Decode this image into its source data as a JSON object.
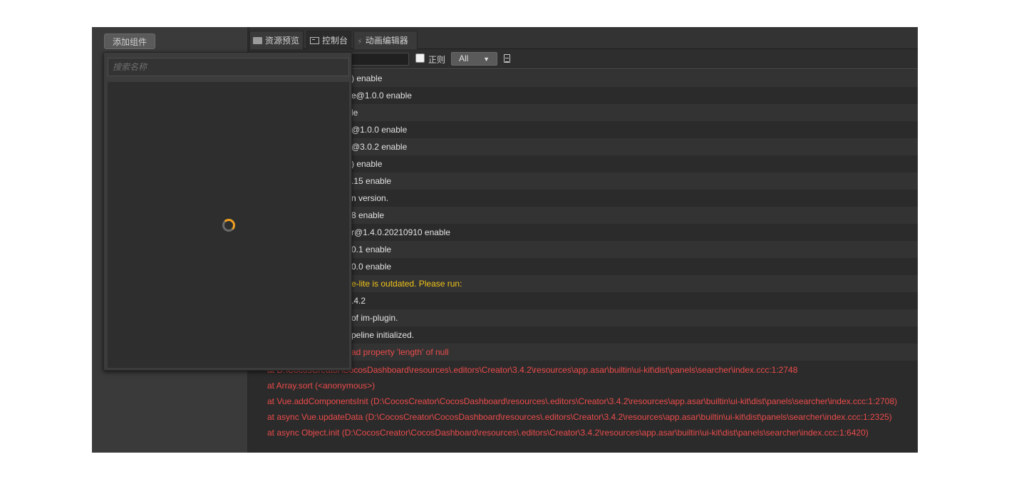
{
  "inspector": {
    "add_component_label": "添加组件"
  },
  "tabs": {
    "assets": "资源预览",
    "console": "控制台",
    "animation": "动画编辑器"
  },
  "filter": {
    "regex_label": "正则",
    "level_value": "All"
  },
  "popup": {
    "search_placeholder": "搜索名称"
  },
  "log": {
    "rows": [
      {
        "text": ") enable",
        "type": "info"
      },
      {
        "text": "e@1.0.0 enable",
        "type": "info"
      },
      {
        "text": "le",
        "type": "info"
      },
      {
        "text": "@1.0.0 enable",
        "type": "info"
      },
      {
        "text": "@3.0.2 enable",
        "type": "info"
      },
      {
        "text": ") enable",
        "type": "info"
      },
      {
        "text": ".15 enable",
        "type": "info"
      },
      {
        "text": "n version.",
        "type": "info"
      },
      {
        "text": "8 enable",
        "type": "info"
      },
      {
        "text": "r@1.4.0.20210910 enable",
        "type": "info"
      },
      {
        "text": "0.1 enable",
        "type": "info"
      },
      {
        "text": "0.0 enable",
        "type": "info"
      },
      {
        "text": "e-lite is outdated. Please run:",
        "type": "warn"
      },
      {
        "text": ".4.2",
        "type": "info"
      },
      {
        "text": "of im-plugin.",
        "type": "info"
      },
      {
        "text": "peline initialized.",
        "type": "info"
      },
      {
        "text": "ad property 'length' of null",
        "type": "err"
      }
    ],
    "stack": [
      "at D:\\CocosCreator\\CocosDashboard\\resources\\.editors\\Creator\\3.4.2\\resources\\app.asar\\builtin\\ui-kit\\dist\\panels\\searcher\\index.ccc:1:2748",
      "at Array.sort (<anonymous>)",
      "at Vue.addComponentsInit (D:\\CocosCreator\\CocosDashboard\\resources\\.editors\\Creator\\3.4.2\\resources\\app.asar\\builtin\\ui-kit\\dist\\panels\\searcher\\index.ccc:1:2708)",
      "at async Vue.updateData (D:\\CocosCreator\\CocosDashboard\\resources\\.editors\\Creator\\3.4.2\\resources\\app.asar\\builtin\\ui-kit\\dist\\panels\\searcher\\index.ccc:1:2325)",
      "at async Object.init (D:\\CocosCreator\\CocosDashboard\\resources\\.editors\\Creator\\3.4.2\\resources\\app.asar\\builtin\\ui-kit\\dist\\panels\\searcher\\index.ccc:1:6420)"
    ]
  },
  "colors": {
    "warn": "#f0c419",
    "error": "#ec4b4b",
    "spinner": "#f0a020"
  }
}
